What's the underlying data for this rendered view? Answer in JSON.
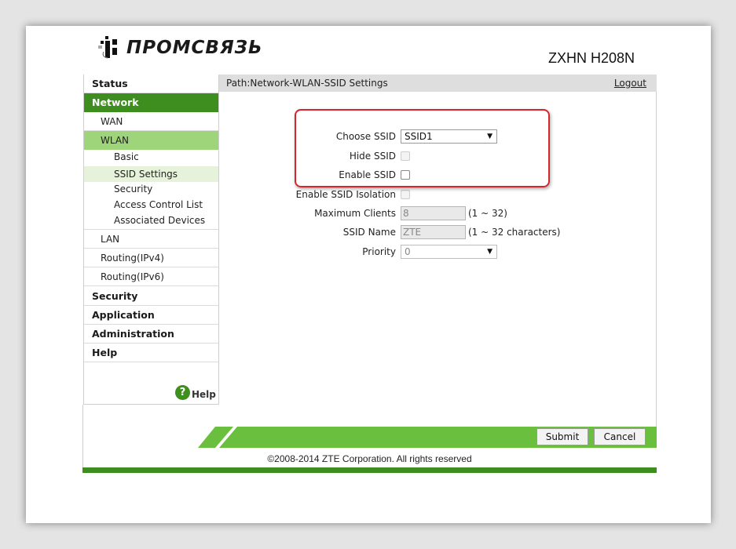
{
  "header": {
    "logo_text": "ПРОМСВЯЗЬ",
    "model": "ZXHN H208N"
  },
  "sidebar": {
    "items": [
      {
        "label": "Status"
      },
      {
        "label": "Network"
      },
      {
        "label": "WAN"
      },
      {
        "label": "WLAN"
      },
      {
        "label": "Basic"
      },
      {
        "label": "SSID Settings"
      },
      {
        "label": "Security"
      },
      {
        "label": "Access Control List"
      },
      {
        "label": "Associated Devices"
      },
      {
        "label": "LAN"
      },
      {
        "label": "Routing(IPv4)"
      },
      {
        "label": "Routing(IPv6)"
      },
      {
        "label": "Security"
      },
      {
        "label": "Application"
      },
      {
        "label": "Administration"
      },
      {
        "label": "Help"
      }
    ],
    "help_link": "Help",
    "help_glyph": "?"
  },
  "pathbar": {
    "path": "Path:Network-WLAN-SSID Settings",
    "logout": "Logout"
  },
  "form": {
    "choose_ssid": {
      "label": "Choose SSID",
      "value": "SSID1"
    },
    "hide_ssid": {
      "label": "Hide SSID",
      "checked": false,
      "disabled": true
    },
    "enable_ssid": {
      "label": "Enable SSID",
      "checked": false
    },
    "enable_ssid_isolation": {
      "label": "Enable SSID Isolation",
      "checked": false,
      "disabled": true
    },
    "maximum_clients": {
      "label": "Maximum Clients",
      "value": "8",
      "hint": "(1 ~ 32)"
    },
    "ssid_name": {
      "label": "SSID Name",
      "value": "ZTE",
      "hint": "(1 ~ 32 characters)"
    },
    "priority": {
      "label": "Priority",
      "value": "0"
    }
  },
  "footer": {
    "submit": "Submit",
    "cancel": "Cancel",
    "copyright": "©2008-2014 ZTE Corporation. All rights reserved"
  },
  "colors": {
    "brand_green": "#3d8e1e",
    "active_sub": "#9ed47a",
    "footer_green": "#6abf3e",
    "highlight_red": "#d5262b"
  }
}
